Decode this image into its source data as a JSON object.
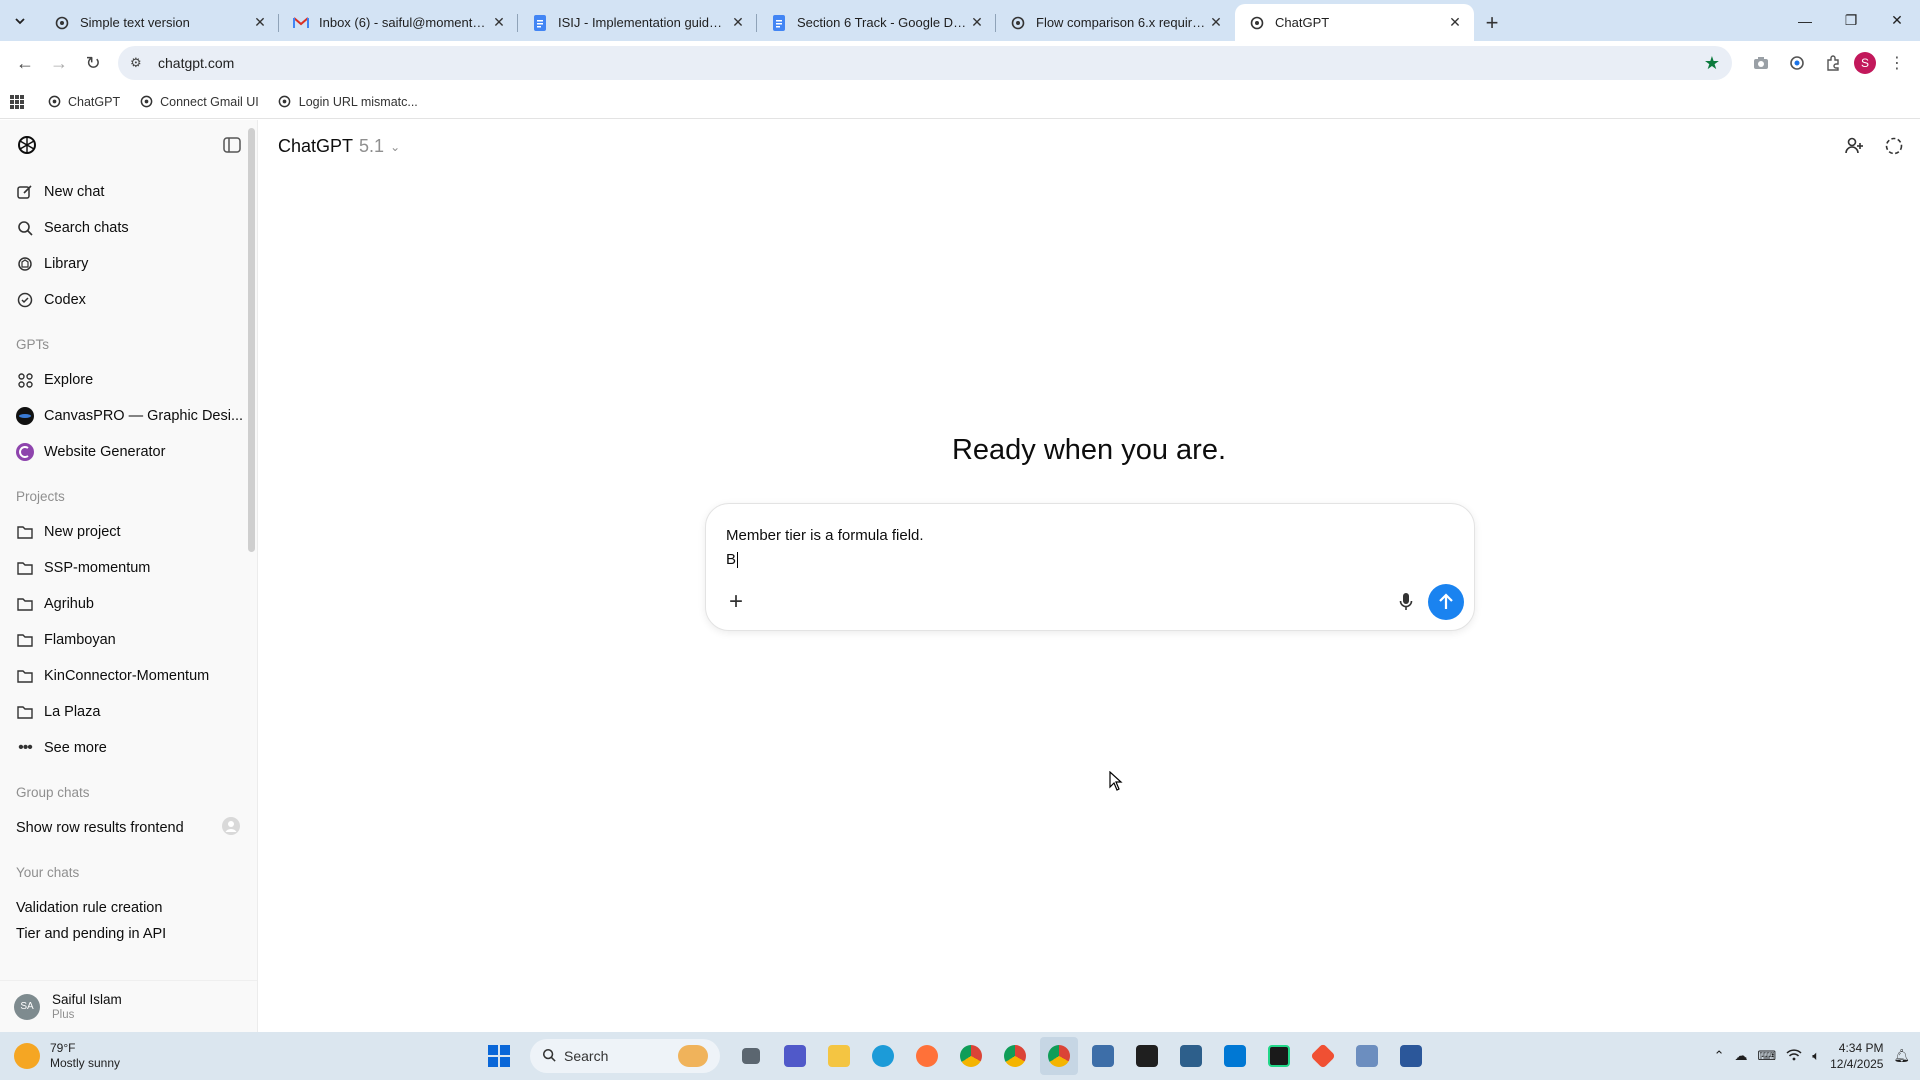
{
  "browser": {
    "tabs": [
      {
        "title": "Simple text version",
        "active": false
      },
      {
        "title": "Inbox (6) - saiful@momentum-...",
        "active": false
      },
      {
        "title": "ISIJ - Implementation guide - G...",
        "active": false
      },
      {
        "title": "Section 6 Track - Google Docs",
        "active": false
      },
      {
        "title": "Flow comparison 6.x requireme...",
        "active": false
      },
      {
        "title": "ChatGPT",
        "active": true
      }
    ],
    "url": "chatgpt.com",
    "profile_initial": "S",
    "bookmarks": [
      "ChatGPT",
      "Connect Gmail UI",
      "Login URL mismatc..."
    ]
  },
  "sidebar": {
    "nav": [
      "New chat",
      "Search chats",
      "Library",
      "Codex"
    ],
    "gpts_heading": "GPTs",
    "gpts": [
      "Explore",
      "CanvasPRO — Graphic Desi...",
      "Website Generator"
    ],
    "projects_heading": "Projects",
    "projects": [
      "New project",
      "SSP-momentum",
      "Agrihub",
      "Flamboyan",
      "KinConnector-Momentum",
      "La Plaza"
    ],
    "see_more": "See more",
    "group_heading": "Group chats",
    "group_chats": [
      "Show row results frontend"
    ],
    "your_heading": "Your chats",
    "your_chats": [
      "Validation rule creation",
      "Tier and pending in API"
    ],
    "user": {
      "initials": "SA",
      "name": "Saiful Islam",
      "plan": "Plus"
    }
  },
  "main": {
    "model_name": "ChatGPT",
    "model_version": "5.1",
    "headline": "Ready when you are.",
    "composer_line1": "Member tier is a formula field.",
    "composer_line2": "B"
  },
  "taskbar": {
    "temp": "79°F",
    "condition": "Mostly sunny",
    "search_label": "Search",
    "time": "4:34 PM",
    "date": "12/4/2025"
  },
  "colors": {
    "send_button": "#1a83f0",
    "tab_bar": "#d3e3f4",
    "bookmark_star": "#0b7a3d"
  }
}
